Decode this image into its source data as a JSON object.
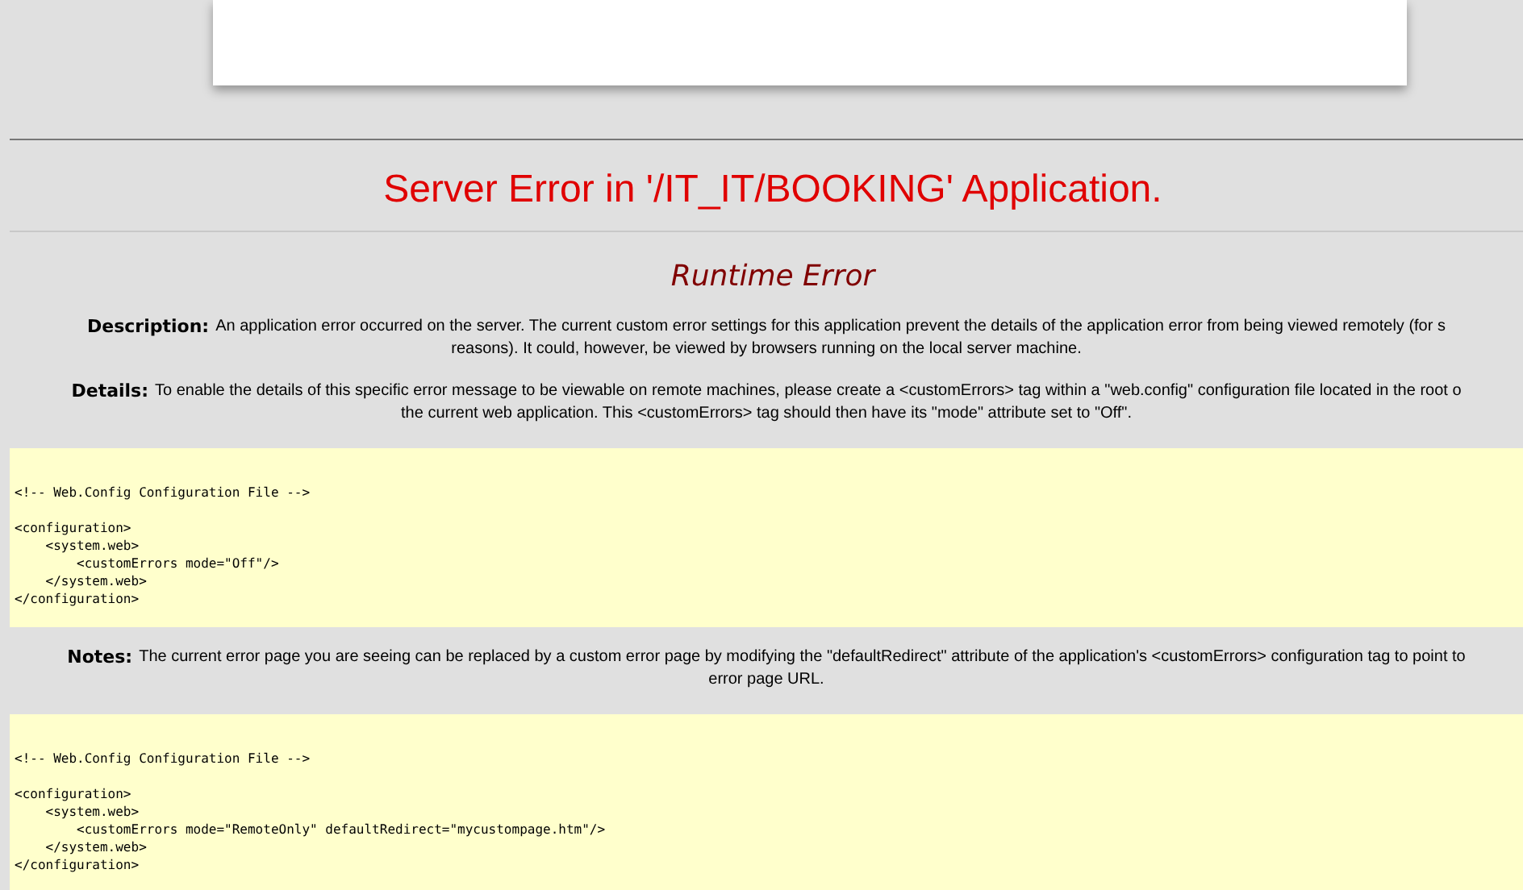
{
  "title": "Server Error in '/IT_IT/BOOKING' Application.",
  "subtitle": "Runtime Error",
  "sections": [
    {
      "kind": "text",
      "label": "Description:",
      "lines": [
        "An application error occurred on the server. The current custom error settings for this application prevent the details of the application error from being viewed remotely (for s",
        "reasons). It could, however, be viewed by browsers running on the local server machine."
      ]
    },
    {
      "kind": "text",
      "label": "Details:",
      "lines": [
        "To enable the details of this specific error message to be viewable on remote machines, please create a <customErrors> tag within a \"web.config\" configuration file located in the root o",
        "the current web application. This <customErrors> tag should then have its \"mode\" attribute set to \"Off\"."
      ]
    },
    {
      "kind": "code",
      "comment": "<!-- Web.Config Configuration File -->",
      "lines": [
        "<configuration>",
        "    <system.web>",
        "        <customErrors mode=\"Off\"/>",
        "    </system.web>",
        "</configuration>"
      ]
    },
    {
      "kind": "text",
      "label": "Notes:",
      "lines": [
        "The current error page you are seeing can be replaced by a custom error page by modifying the \"defaultRedirect\" attribute of the application's <customErrors> configuration tag to point to",
        "error page URL."
      ]
    },
    {
      "kind": "code",
      "comment": "<!-- Web.Config Configuration File -->",
      "lines": [
        "<configuration>",
        "    <system.web>",
        "        <customErrors mode=\"RemoteOnly\" defaultRedirect=\"mycustompage.htm\"/>",
        "    </system.web>",
        "</configuration>"
      ]
    }
  ]
}
